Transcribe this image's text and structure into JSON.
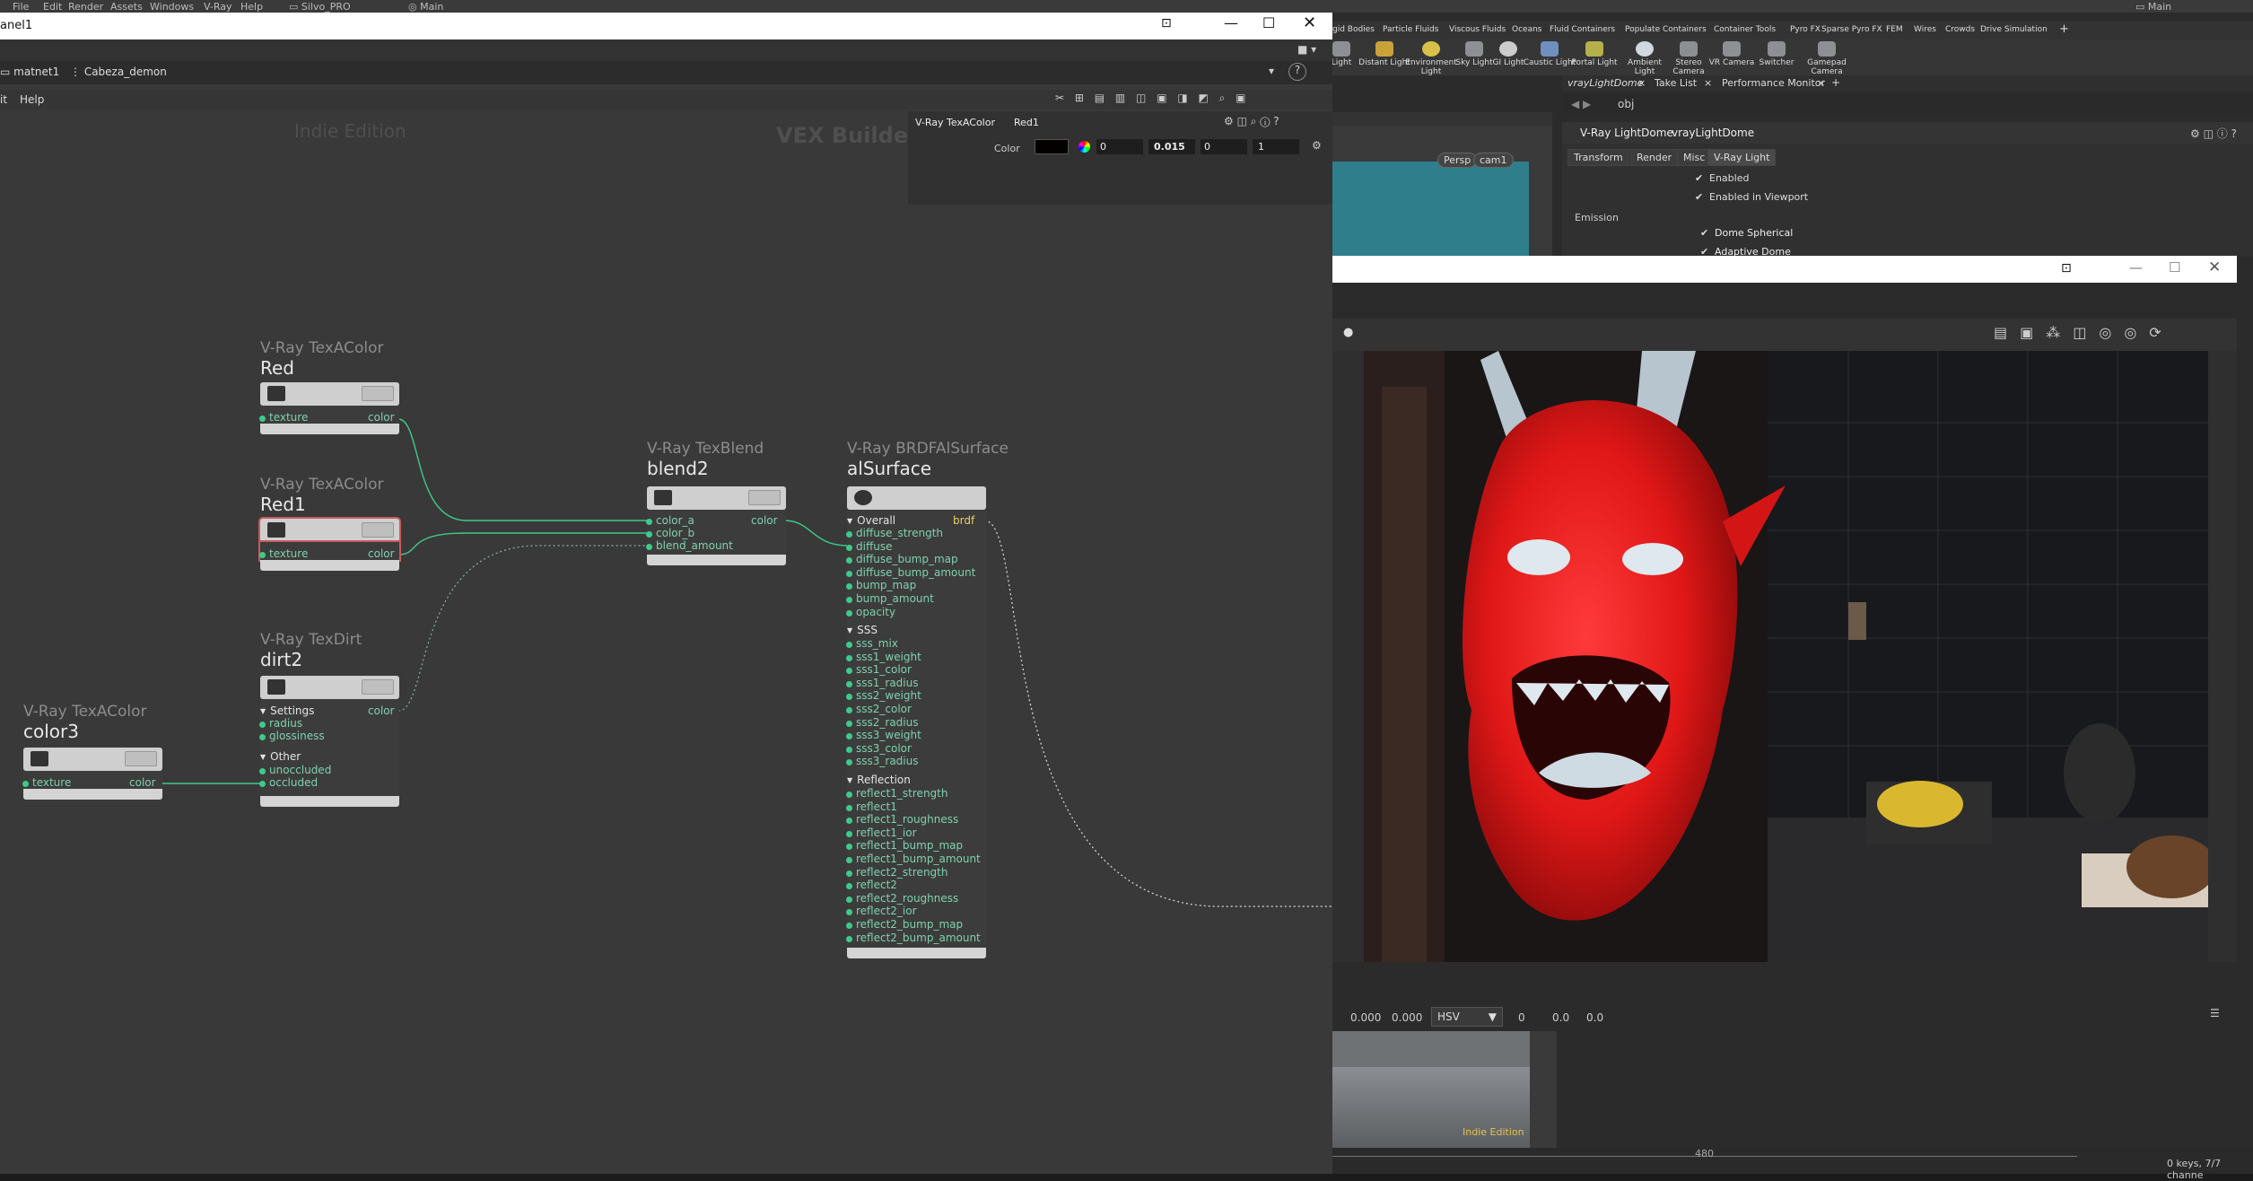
{
  "top_menu": {
    "items": [
      "File",
      "Edit",
      "Render",
      "Assets",
      "Windows",
      "V-Ray",
      "Help"
    ],
    "desktop_label": "Silvo_PRO",
    "desktop2_label": "Main",
    "right_label": "Main"
  },
  "shelf": {
    "tabs": [
      "gid Bodies",
      "Particle Fluids",
      "Viscous Fluids",
      "Oceans",
      "Fluid Containers",
      "Populate Containers",
      "Container Tools",
      "Pyro FX",
      "Sparse Pyro FX",
      "FEM",
      "Wires",
      "Crowds",
      "Drive Simulation"
    ],
    "plus": "+",
    "tools": [
      {
        "label": "Light",
        "icon": "light-icon"
      },
      {
        "label": "Distant Light",
        "icon": "distant-light-icon"
      },
      {
        "label": "Environment Light",
        "icon": "environment-light-icon"
      },
      {
        "label": "Sky Light",
        "icon": "sky-light-icon"
      },
      {
        "label": "GI Light",
        "icon": "gi-light-icon"
      },
      {
        "label": "Caustic Light",
        "icon": "caustic-light-icon"
      },
      {
        "label": "Portal Light",
        "icon": "portal-light-icon"
      },
      {
        "label": "Ambient Light",
        "icon": "ambient-light-icon"
      },
      {
        "label": "Stereo Camera",
        "icon": "stereo-camera-icon"
      },
      {
        "label": "VR Camera",
        "icon": "vr-camera-icon"
      },
      {
        "label": "Switcher",
        "icon": "switcher-icon"
      },
      {
        "label": "Gamepad Camera",
        "icon": "gamepad-camera-icon"
      }
    ]
  },
  "pane_tabs": {
    "tabs": [
      "vrayLightDome",
      "Take List",
      "Performance Monitor"
    ],
    "path": "obj"
  },
  "viewport": {
    "persp": "Persp",
    "camera": "cam1",
    "indie": "Indie Edition",
    "frame_mid": "480",
    "keys_status": "0 keys, 7/7 channe"
  },
  "right_params": {
    "node_type": "V-Ray LightDome",
    "node_name": "vrayLightDome",
    "tabs": [
      "Transform",
      "Render",
      "Misc",
      "V-Ray Light"
    ],
    "enabled": "Enabled",
    "enabled_viewport": "Enabled in Viewport",
    "emission": "Emission",
    "dome_spherical": "Dome Spherical",
    "adaptive_dome": "Adaptive Dome"
  },
  "node_window": {
    "title": "anel1",
    "path_root": "matnet1",
    "path_child": "Cabeza_demon",
    "menu": [
      "it",
      "Help"
    ],
    "watermark": "Indie Edition",
    "context": "VEX Builder",
    "param": {
      "node_type": "V-Ray TexAColor",
      "node_name": "Red1",
      "label": "Color",
      "values": [
        "0",
        "0.015",
        "0",
        "1"
      ]
    }
  },
  "nodes": {
    "red": {
      "type": "V-Ray TexAColor",
      "name": "Red",
      "in": "texture",
      "out": "color"
    },
    "red1": {
      "type": "V-Ray TexAColor",
      "name": "Red1",
      "in": "texture",
      "out": "color"
    },
    "dirt2": {
      "type": "V-Ray TexDirt",
      "name": "dirt2",
      "out": "color",
      "settings": "Settings",
      "settings_ports": [
        "radius",
        "glossiness"
      ],
      "other": "Other",
      "other_ports": [
        "unoccluded",
        "occluded"
      ]
    },
    "color3": {
      "type": "V-Ray TexAColor",
      "name": "color3",
      "in": "texture",
      "out": "color"
    },
    "blend2": {
      "type": "V-Ray TexBlend",
      "name": "blend2",
      "ports": [
        "color_a",
        "color_b",
        "blend_amount"
      ],
      "out": "color"
    },
    "alsurface": {
      "type": "V-Ray BRDFAlSurface",
      "name": "alSurface",
      "out": "brdf",
      "overall": "Overall",
      "overall_ports": [
        "diffuse_strength",
        "diffuse",
        "diffuse_bump_map",
        "diffuse_bump_amount",
        "bump_map",
        "bump_amount",
        "opacity"
      ],
      "sss": "SSS",
      "sss_ports": [
        "sss_mix",
        "sss1_weight",
        "sss1_color",
        "sss1_radius",
        "sss2_weight",
        "sss2_color",
        "sss2_radius",
        "sss3_weight",
        "sss3_color",
        "sss3_radius"
      ],
      "reflection": "Reflection",
      "reflection_ports": [
        "reflect1_strength",
        "reflect1",
        "reflect1_roughness",
        "reflect1_ior",
        "reflect1_bump_map",
        "reflect1_bump_amount",
        "reflect2_strength",
        "reflect2",
        "reflect2_roughness",
        "reflect2_ior",
        "reflect2_bump_map",
        "reflect2_bump_amount"
      ]
    }
  },
  "render_window": {
    "bottom_values": [
      "0.000",
      "0.000"
    ],
    "color_mode": "HSV",
    "hsv_values": [
      "0",
      "0.0",
      "0.0"
    ]
  },
  "colors": {
    "wire_green": "#3ecb8a",
    "port_text": "#7fd1b0",
    "demon_red": "#e01717",
    "viewport_teal": "#2f7e8c"
  }
}
